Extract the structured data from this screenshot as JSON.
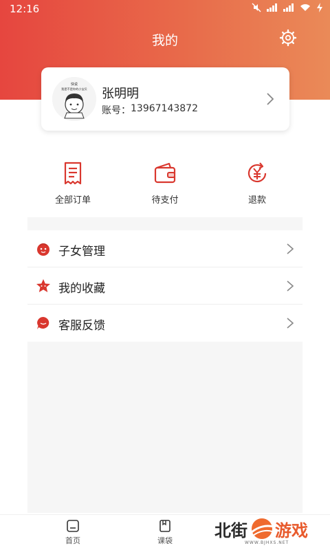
{
  "status_bar": {
    "time": "12:16"
  },
  "header": {
    "title": "我的"
  },
  "profile": {
    "avatar_caption_1": "快说",
    "avatar_caption_2": "我是不是你的小宝贝",
    "name": "张明明",
    "account_label": "账号：",
    "account_number": "13967143872"
  },
  "orders": {
    "items": [
      {
        "label": "全部订单",
        "icon": "receipt-icon"
      },
      {
        "label": "待支付",
        "icon": "wallet-icon"
      },
      {
        "label": "退款",
        "icon": "refund-icon"
      }
    ]
  },
  "menu": {
    "items": [
      {
        "label": "子女管理",
        "icon": "child-face-icon"
      },
      {
        "label": "我的收藏",
        "icon": "star-icon"
      },
      {
        "label": "客服反馈",
        "icon": "chat-bubble-icon"
      }
    ]
  },
  "tab_bar": {
    "items": [
      {
        "label": "首页",
        "icon": "home-icon"
      },
      {
        "label": "课袋",
        "icon": "book-icon"
      }
    ]
  },
  "watermark": {
    "text_left": "北街",
    "text_right": "游戏",
    "sub": "WWW.BJHXS.NET"
  },
  "colors": {
    "accent": "#e6463f",
    "accent_end": "#ea8a58",
    "icon_red": "#d9372e"
  }
}
